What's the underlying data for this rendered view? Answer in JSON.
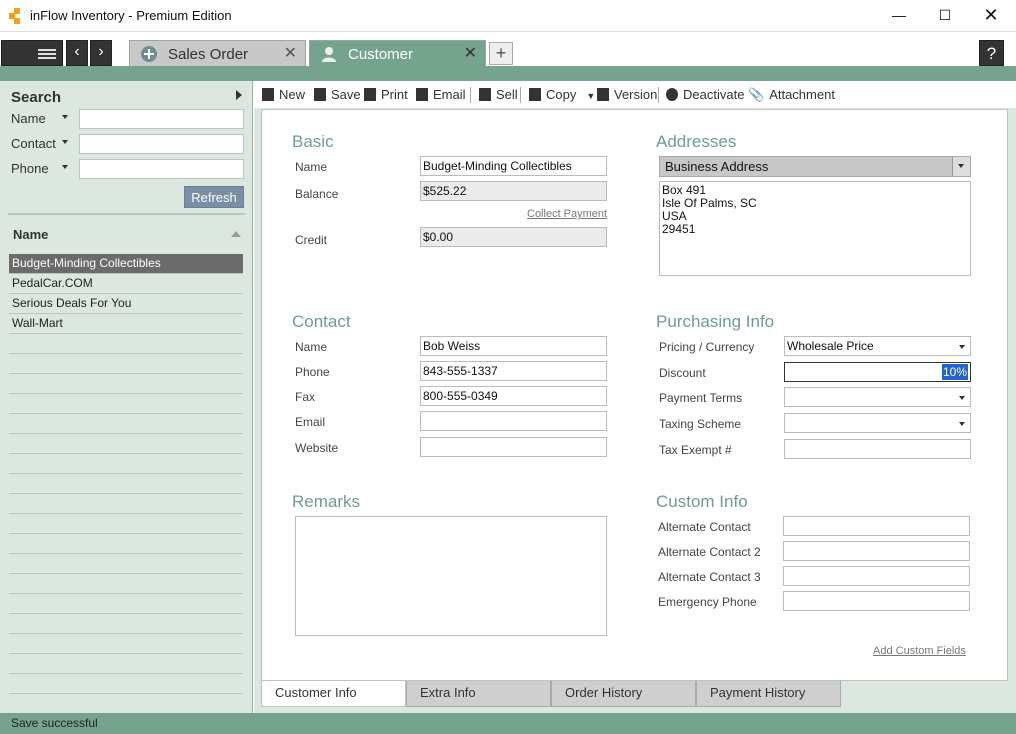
{
  "window": {
    "title": "inFlow Inventory - Premium Edition"
  },
  "tabs": [
    {
      "label": "Sales Order"
    },
    {
      "label": "Customer"
    }
  ],
  "help_label": "?",
  "search": {
    "title": "Search",
    "fields": [
      {
        "label": "Name",
        "value": ""
      },
      {
        "label": "Contact",
        "value": ""
      },
      {
        "label": "Phone",
        "value": ""
      }
    ],
    "refresh_label": "Refresh"
  },
  "list": {
    "header": "Name",
    "rows": [
      "Budget-Minding Collectibles",
      "PedalCar.COM",
      "Serious Deals For You",
      "Wall-Mart"
    ],
    "selected_index": 0
  },
  "toolbar": {
    "new": "New",
    "save": "Save",
    "print": "Print",
    "email": "Email",
    "sell": "Sell",
    "copy": "Copy",
    "version": "Version",
    "deactivate": "Deactivate",
    "attachment": "Attachment"
  },
  "basic": {
    "title": "Basic",
    "name_label": "Name",
    "name_value": "Budget-Minding Collectibles",
    "balance_label": "Balance",
    "balance_value": "$525.22",
    "collect_payment": "Collect Payment",
    "credit_label": "Credit",
    "credit_value": "$0.00"
  },
  "addresses": {
    "title": "Addresses",
    "type": "Business Address",
    "lines": [
      "Box 491",
      "Isle Of Palms, SC",
      "USA",
      "29451"
    ]
  },
  "contact": {
    "title": "Contact",
    "name_label": "Name",
    "name_value": "Bob Weiss",
    "phone_label": "Phone",
    "phone_value": "843-555-1337",
    "fax_label": "Fax",
    "fax_value": "800-555-0349",
    "email_label": "Email",
    "email_value": "",
    "website_label": "Website",
    "website_value": ""
  },
  "purchasing": {
    "title": "Purchasing Info",
    "pricing_label": "Pricing / Currency",
    "pricing_value": "Wholesale Price",
    "discount_label": "Discount",
    "discount_value": "10%",
    "terms_label": "Payment Terms",
    "terms_value": "",
    "taxing_label": "Taxing Scheme",
    "taxing_value": "",
    "exempt_label": "Tax Exempt #",
    "exempt_value": ""
  },
  "remarks": {
    "title": "Remarks",
    "value": ""
  },
  "custom": {
    "title": "Custom Info",
    "fields": [
      {
        "label": "Alternate Contact",
        "value": ""
      },
      {
        "label": "Alternate Contact 2",
        "value": ""
      },
      {
        "label": "Alternate Contact 3",
        "value": ""
      },
      {
        "label": "Emergency Phone",
        "value": ""
      }
    ],
    "add_link": "Add Custom Fields"
  },
  "bottom_tabs": [
    "Customer Info",
    "Extra Info",
    "Order History",
    "Payment History"
  ],
  "status": {
    "text": "Save successful"
  },
  "colors": {
    "accent": "#76a38e",
    "section_title": "#6e9e87",
    "sidebar_bg": "#dbe7df",
    "selected_row": "#6b6b6b"
  }
}
